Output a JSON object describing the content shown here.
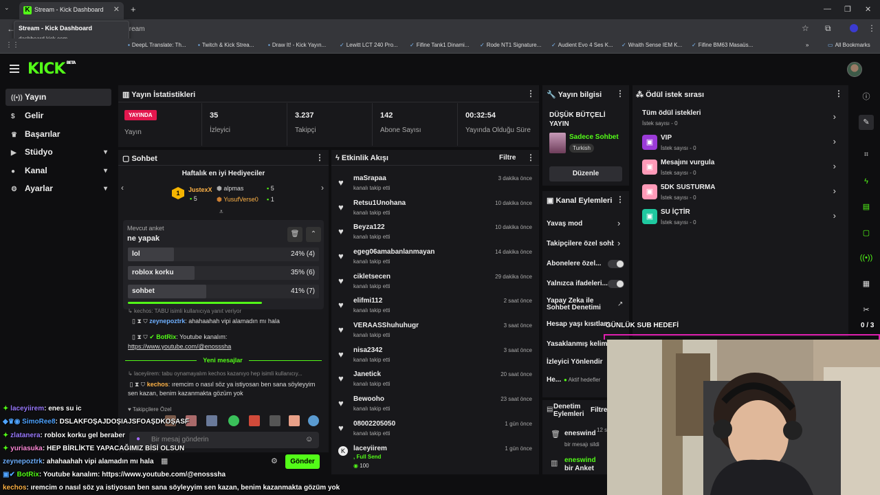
{
  "browser": {
    "tab_title": "Stream - Kick Dashboard",
    "tooltip_title": "Stream - Kick Dashboard",
    "tooltip_url": "dashboard.kick.com",
    "url_fragment": "stream",
    "bookmarks": [
      "DeepL Translate: Th...",
      "Twitch & Kick Strea...",
      "Draw It! - Kick Yayın...",
      "Lewitt LCT 240 Pro...",
      "Fifine Tank1 Dinami...",
      "Rode NT1 Signature...",
      "Audient Evo 4 Ses K...",
      "Wraith Sense IEM K...",
      "Fifine BM63 Masaüs..."
    ],
    "all_bookmarks": "All Bookmarks"
  },
  "brand": {
    "logo": "KICK",
    "beta": "BETA"
  },
  "sidebar": [
    {
      "label": "Yayın",
      "icon": "broadcast-icon"
    },
    {
      "label": "Gelir",
      "icon": "dollar-icon"
    },
    {
      "label": "Başarılar",
      "icon": "trophy-icon"
    },
    {
      "label": "Stüdyo",
      "icon": "video-icon"
    },
    {
      "label": "Kanal",
      "icon": "user-icon"
    },
    {
      "label": "Ayarlar",
      "icon": "gear-icon"
    }
  ],
  "stats": {
    "title": "Yayın İstatistikleri",
    "live_badge": "YAYINDA",
    "live_label": "Yayın",
    "viewers": "35",
    "viewers_label": "İzleyici",
    "followers": "3.237",
    "followers_label": "Takipçi",
    "subs": "142",
    "subs_label": "Abone Sayısı",
    "uptime": "00:32:54",
    "uptime_label": "Yayında Olduğu Süre"
  },
  "stream_info": {
    "title": "Yayın bilgisi",
    "stream_title": "DÜŞÜK BÜTÇELİ YAYIN",
    "category": "Sadece Sohbet",
    "tag": "Turkish",
    "edit": "Düzenle"
  },
  "rewards": {
    "title": "Ödül istek sırası",
    "items": [
      {
        "name": "Tüm ödül istekleri",
        "count": "İstek sayısı - 0"
      },
      {
        "name": "VIP",
        "count": "İstek sayısı - 0",
        "color": "#9b3bd8"
      },
      {
        "name": "Mesajını vurgula",
        "count": "İstek sayısı - 0",
        "color": "#ff5f8f"
      },
      {
        "name": "5DK SUSTURMA",
        "count": "İstek sayısı - 0",
        "color": "#ff5f8f"
      },
      {
        "name": "SU İÇTİR",
        "count": "İstek sayısı - 0",
        "color": "#1fc9a0"
      }
    ]
  },
  "chat": {
    "title": "Sohbet",
    "gifters_title": "Haftalık en iyi Hediyeciler",
    "gifters": [
      {
        "name": "JustexX",
        "count": "5",
        "rank": "1"
      },
      {
        "name": "alpmas",
        "count": "5"
      },
      {
        "name": "YusufVerse0",
        "count": "1"
      }
    ],
    "poll": {
      "label": "Mevcut anket",
      "question": "ne yapak",
      "options": [
        {
          "name": "lol",
          "pct": "24% (4)",
          "value": 24
        },
        {
          "name": "roblox korku",
          "pct": "35% (6)",
          "value": 35
        },
        {
          "name": "sohbet",
          "pct": "41% (7)",
          "value": 41
        }
      ]
    },
    "reply_1": "kechos: TABU isimli kullanıcıya yanıt veriyor",
    "msg_1_user": "zeynepoztrk",
    "msg_1_text": ": ahahaahah vipi alamadın mı hala",
    "msg_2_user": "BotRix",
    "msg_2_text": ": Youtube kanalım:",
    "msg_2_link": "https://www.youtube.com/@enosssha",
    "new_messages": "Yeni mesajlar",
    "reply_2": "laceyiirem: tabu oynamayalım kechos kazanıyo hep isimli kullanıcıy...",
    "msg_3_user": "kechos",
    "msg_3_text": ": ıremcim o nasıl söz ya istiyosan ben sana söyleyyim sen kazan, benim kazanmakta gözüm yok",
    "followers_only": "Takipçilere Özel",
    "placeholder": "Bir mesaj gönderin",
    "send": "Gönder"
  },
  "activity": {
    "title": "Etkinlik Akışı",
    "filter": "Filtre",
    "events": [
      {
        "name": "maSrapaa",
        "sub": "kanalı takip etti",
        "time": "3 dakika önce"
      },
      {
        "name": "Retsu1Unohana",
        "sub": "kanalı takip etti",
        "time": "10 dakika önce"
      },
      {
        "name": "Beyza122",
        "sub": "kanalı takip etti",
        "time": "10 dakika önce"
      },
      {
        "name": "egeg06amabanlanmayan",
        "sub": "kanalı takip etti",
        "time": "14 dakika önce"
      },
      {
        "name": "cikletsecen",
        "sub": "kanalı takip etti",
        "time": "29 dakika önce"
      },
      {
        "name": "elifmi112",
        "sub": "kanalı takip etti",
        "time": "2 saat önce"
      },
      {
        "name": "VERAASShuhuhugr",
        "sub": "kanalı takip etti",
        "time": "3 saat önce"
      },
      {
        "name": "nisa2342",
        "sub": "kanalı takip etti",
        "time": "3 saat önce"
      },
      {
        "name": "Janetick",
        "sub": "kanalı takip etti",
        "time": "20 saat önce"
      },
      {
        "name": "Bewooho",
        "sub": "kanalı takip etti",
        "time": "23 saat önce"
      },
      {
        "name": "08002205050",
        "sub": "kanalı takip etti",
        "time": "1 gün önce"
      }
    ],
    "last": {
      "name": "laceyiirem",
      "sub": ", Full Send",
      "time": "1 gün önce",
      "amount": "100"
    }
  },
  "channel_actions": {
    "title": "Kanal Eylemleri",
    "items": [
      "Yavaş mod",
      "Takipçilere özel sohbet",
      "Abonelere özel...",
      "Yalnızca ifadeleri...",
      "Yapay Zeka ile Sohbet Denetimi",
      "Hesap yaşı kısıtlama",
      "Yasaklanmış kelime",
      "İzleyici Yönlendir",
      "He..."
    ],
    "ai_line2": "Sohbet Denetimi",
    "ai_line1": "Yapay Zeka ile",
    "active_hedefler": "Aktif hedefler"
  },
  "moderation": {
    "title": "Denetim Eylemleri",
    "filter": "Filtre",
    "items": [
      {
        "user": "eneswind",
        "text": "bir mesajı sildi",
        "time": "12 s"
      },
      {
        "user": "eneswind",
        "text": "bir Anket"
      }
    ]
  },
  "overlay": {
    "goal": "GÜNLÜK SUB HEDEFİ",
    "goal_count": "0 / 3",
    "chat": [
      {
        "user": "laceyiirem",
        "text": ": enes su ic",
        "color": "#9b7bff"
      },
      {
        "user": "SimoRee8",
        "text": ": DSLAKFOŞAJDOŞIAJSFOAŞDKOŞASF",
        "color": "#4fa3ff"
      },
      {
        "user": "zlatanera",
        "text": ": roblox korku gel beraber",
        "color": "#9b7bff"
      },
      {
        "user": "yuriasuka",
        "text": ": HEP BİRLİKTE YAPACAĞIMIZ BİSİ OLSUN",
        "color": "#ff8ad8"
      },
      {
        "user": "zeynepoztrk",
        "text": ": ahahaahah vipi alamadın mı hala",
        "color": "#6fb0ff"
      },
      {
        "user": "BotRix",
        "text": ": Youtube kanalım: https://www.youtube.com/@enosssha",
        "color": "#53fc18"
      },
      {
        "user": "kechos",
        "text": ": ıremcim o nasıl söz ya istiyosan ben sana söyleyyim sen kazan, benim kazanmakta gözüm yok",
        "color": "#ffb347"
      }
    ]
  }
}
